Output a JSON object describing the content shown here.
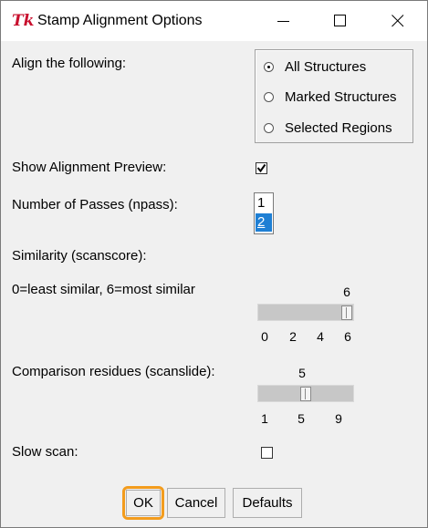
{
  "window": {
    "title": "Stamp Alignment Options",
    "icon": "tk-feather-icon",
    "controls": [
      "minimize",
      "maximize",
      "close"
    ]
  },
  "align": {
    "label": "Align the following:",
    "options": [
      {
        "label": "All Structures",
        "selected": true
      },
      {
        "label": "Marked Structures",
        "selected": false
      },
      {
        "label": "Selected Regions",
        "selected": false
      }
    ]
  },
  "preview": {
    "label": "Show Alignment Preview:",
    "checked": true
  },
  "passes": {
    "label": "Number of Passes (npass):",
    "items": [
      "1",
      "2"
    ],
    "selected": "2"
  },
  "similarity": {
    "label": "Similarity (scanscore):",
    "note": "0=least similar, 6=most similar",
    "value": "6",
    "ticks": [
      "0",
      "2",
      "4",
      "6"
    ],
    "min": 0,
    "max": 6
  },
  "residues": {
    "label": "Comparison residues (scanslide):",
    "value": "5",
    "ticks": [
      "1",
      "5",
      "9"
    ],
    "min": 1,
    "max": 9
  },
  "slow_scan": {
    "label": "Slow scan:",
    "checked": false
  },
  "buttons": {
    "ok": "OK",
    "cancel": "Cancel",
    "defaults": "Defaults"
  },
  "colors": {
    "highlight": "#f39c1d",
    "selection": "#1e7fd4",
    "title_icon": "#c8102e"
  }
}
